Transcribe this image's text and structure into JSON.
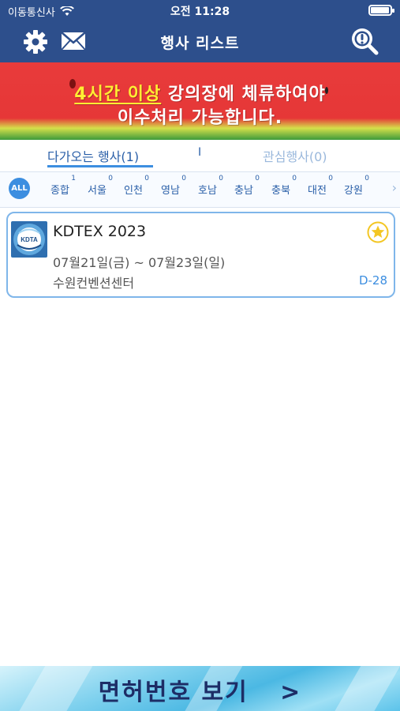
{
  "status_bar": {
    "carrier": "이동통신사",
    "time": "오전 11:28",
    "battery_level": 0.95
  },
  "nav": {
    "title": "행사 리스트",
    "left_icons": [
      "gear-icon",
      "mail-icon"
    ],
    "right_icon": "search-icon"
  },
  "banner": {
    "highlight": "4시간 이상",
    "line1_rest": " 강의장에 체류하여야",
    "line2": "이수처리 가능합니다."
  },
  "tabs": {
    "upcoming": "다가오는 행사(1)",
    "divider": "I",
    "interest": "관심행사(0)"
  },
  "regions": {
    "all_label": "ALL",
    "items": [
      {
        "label": "종합",
        "count": "1"
      },
      {
        "label": "서울",
        "count": "0"
      },
      {
        "label": "인천",
        "count": "0"
      },
      {
        "label": "영남",
        "count": "0"
      },
      {
        "label": "호남",
        "count": "0"
      },
      {
        "label": "충남",
        "count": "0"
      },
      {
        "label": "충북",
        "count": "0"
      },
      {
        "label": "대전",
        "count": "0"
      },
      {
        "label": "강원",
        "count": "0"
      }
    ],
    "more_icon": "chevron-right-icon"
  },
  "events": [
    {
      "logo_text": "KDTA",
      "title": "KDTEX 2023",
      "dates": "07월21일(금) ~ 07월23일(일)",
      "venue": "수원컨벤션센터",
      "dday": "D-28",
      "favorite_icon": "star-icon"
    }
  ],
  "bottom_bar": {
    "label": "면허번호 보기",
    "arrow": ">"
  },
  "colors": {
    "header": "#2d4f8c",
    "accent": "#3c8ee0",
    "banner_red": "#e63737",
    "banner_highlight": "#ffee33",
    "star": "#f3c623"
  }
}
